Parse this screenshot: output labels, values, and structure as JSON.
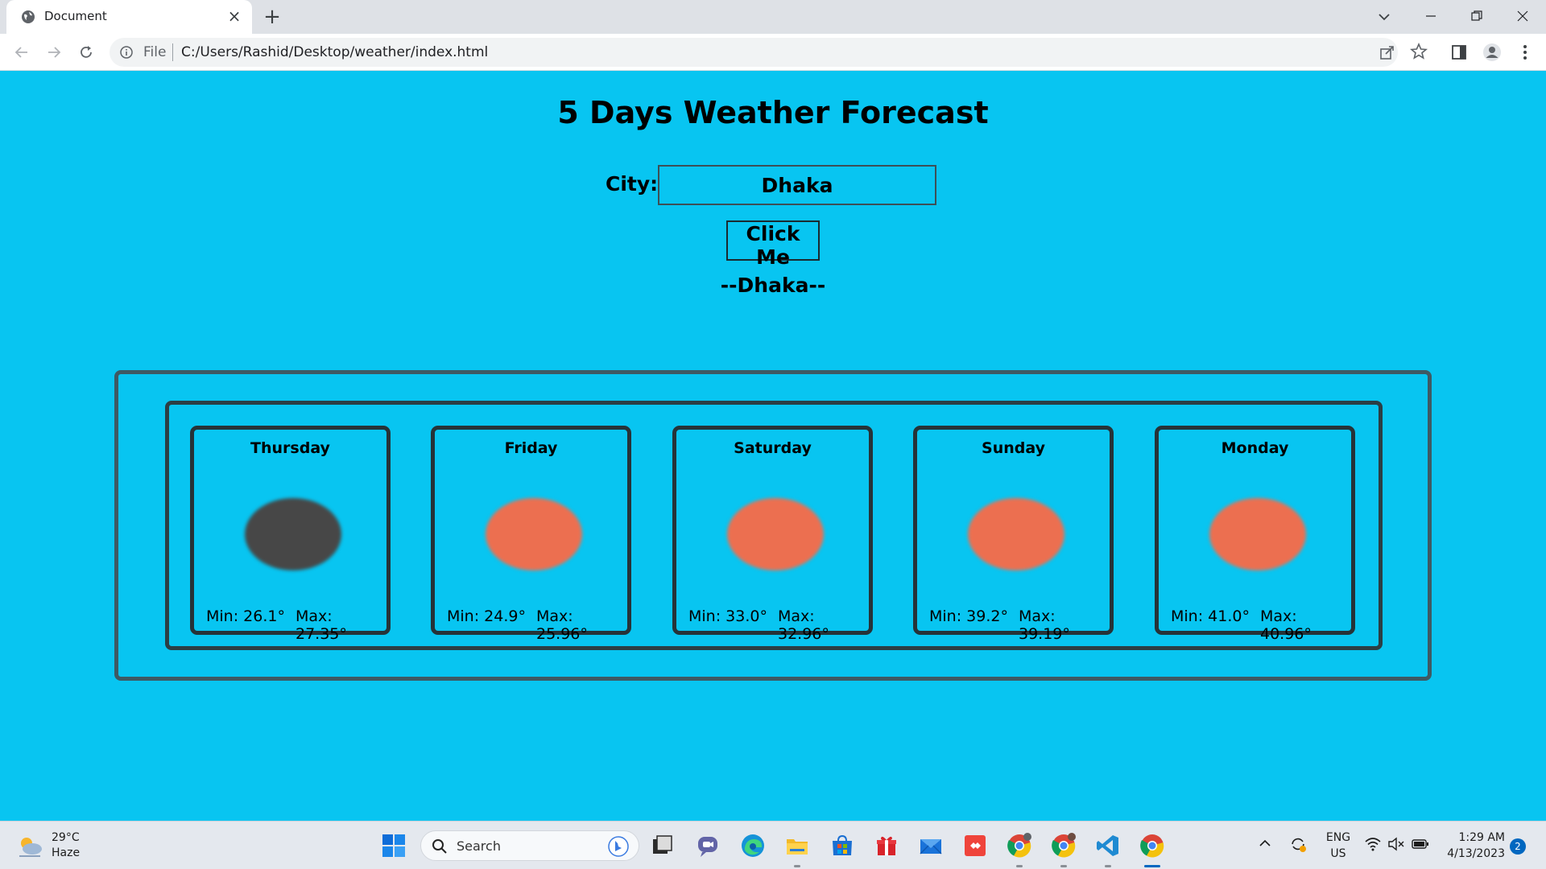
{
  "browser": {
    "tab_title": "Document",
    "tab_close": "×",
    "new_tab": "+",
    "omnibox_scheme": "File",
    "omnibox_url": "C:/Users/Rashid/Desktop/weather/index.html"
  },
  "page": {
    "title": "5 Days Weather Forecast",
    "city_label": "City:",
    "city_value": "Dhaka",
    "button_label": "Click Me",
    "city_display": "--Dhaka--"
  },
  "forecast": [
    {
      "day": "Thursday",
      "min": "Min: 26.1°",
      "max": "Max: 27.35°",
      "icon": "dark-cloud-blob",
      "color": "#474747"
    },
    {
      "day": "Friday",
      "min": "Min: 24.9°",
      "max": "Max: 25.96°",
      "icon": "sun-blob",
      "color": "#ec6f50"
    },
    {
      "day": "Saturday",
      "min": "Min: 33.0°",
      "max": "Max: 32.96°",
      "icon": "sun-blob",
      "color": "#ec6f50"
    },
    {
      "day": "Sunday",
      "min": "Min: 39.2°",
      "max": "Max: 39.19°",
      "icon": "sun-blob",
      "color": "#ec6f50"
    },
    {
      "day": "Monday",
      "min": "Min: 41.0°",
      "max": "Max: 40.96°",
      "icon": "sun-blob",
      "color": "#ec6f50"
    }
  ],
  "taskbar": {
    "weather_temp": "29°C",
    "weather_desc": "Haze",
    "search_placeholder": "Search",
    "lang_line1": "ENG",
    "lang_line2": "US",
    "time": "1:29 AM",
    "date": "4/13/2023",
    "notification_count": "2"
  },
  "colors": {
    "page_background": "#08c5f1",
    "sun": "#ec6f50",
    "cloud": "#474747"
  }
}
